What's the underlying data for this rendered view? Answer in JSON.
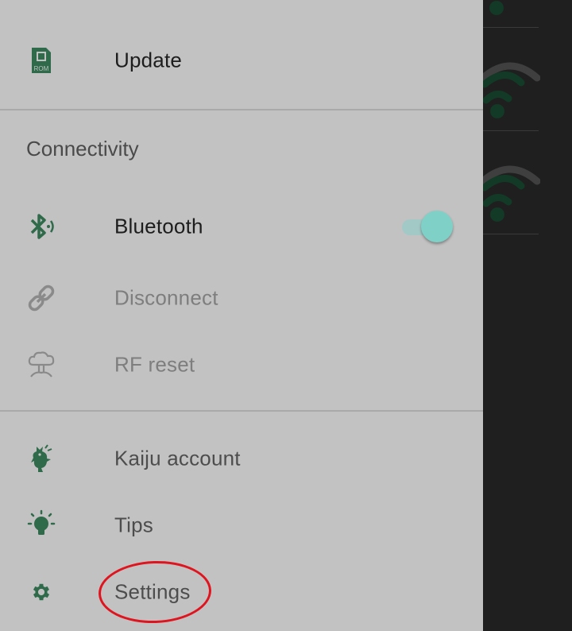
{
  "colors": {
    "drawer_bg": "#c2c2c2",
    "icon_green": "#2f6a4a",
    "icon_disabled": "#8a8a8a",
    "toggle_on": "#7fd1c8",
    "annotation_red": "#e0141e",
    "scrim": "#1e1e1e"
  },
  "menu": {
    "update": {
      "label": "Update",
      "icon": "rom-chip-icon",
      "icon_text": "ROM"
    },
    "connectivity_header": "Connectivity",
    "bluetooth": {
      "label": "Bluetooth",
      "icon": "bluetooth-audio-icon",
      "toggle_on": true
    },
    "disconnect": {
      "label": "Disconnect",
      "icon": "link-icon",
      "enabled": false
    },
    "rf_reset": {
      "label": "RF reset",
      "icon": "mushroom-cloud-icon",
      "enabled": false
    },
    "kaiju_account": {
      "label": "Kaiju account",
      "icon": "kaiju-icon"
    },
    "tips": {
      "label": "Tips",
      "icon": "lightbulb-icon"
    },
    "settings": {
      "label": "Settings",
      "icon": "gear-icon",
      "annotated": true
    }
  },
  "background_app": {
    "icons": [
      "wifi-signal-icon",
      "wifi-signal-icon"
    ]
  }
}
